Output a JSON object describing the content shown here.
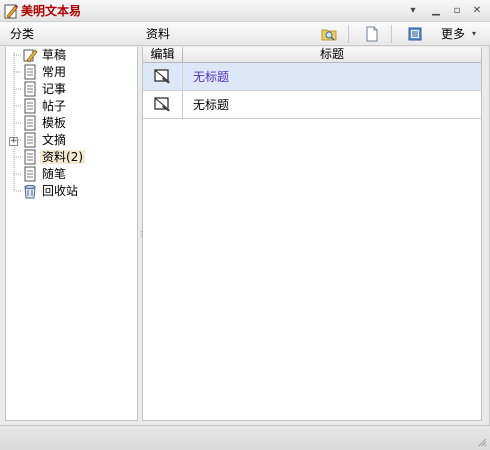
{
  "window": {
    "title": "美明文本易"
  },
  "titlebar": {
    "menu_glyph": "▾",
    "min_glyph": "▁",
    "max_glyph": "▫",
    "close_glyph": "✕"
  },
  "header": {
    "category_label": "分类",
    "section_label": "资料",
    "more_label": "更多",
    "more_arrow": "▾"
  },
  "tree": {
    "items": [
      {
        "label": "草稿",
        "icon": "draft-pencil-icon"
      },
      {
        "label": "常用",
        "icon": "document-icon"
      },
      {
        "label": "记事",
        "icon": "document-icon"
      },
      {
        "label": "帖子",
        "icon": "document-icon"
      },
      {
        "label": "模板",
        "icon": "document-icon"
      },
      {
        "label": "文摘",
        "icon": "document-icon",
        "expandable": true
      },
      {
        "label": "资料",
        "count": "(2)",
        "icon": "document-icon",
        "selected": true
      },
      {
        "label": "随笔",
        "icon": "document-icon"
      },
      {
        "label": "回收站",
        "icon": "recycle-bin-icon"
      }
    ],
    "expander_glyph": "+"
  },
  "list": {
    "columns": {
      "edit": "编辑",
      "title": "标题"
    },
    "rows": [
      {
        "title": "无标题",
        "selected": true
      },
      {
        "title": "无标题",
        "selected": false
      }
    ]
  },
  "colors": {
    "title_red": "#b00000",
    "selected_row": "#dce8f8",
    "selected_text": "#5a2fc4",
    "tree_selected": "#f3ead2"
  }
}
